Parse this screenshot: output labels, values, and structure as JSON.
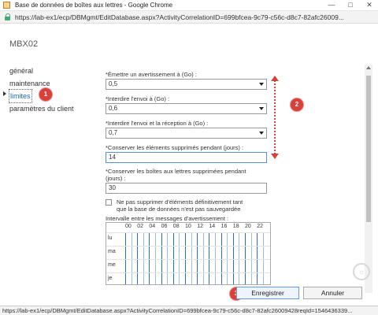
{
  "window": {
    "title": "Base de données de boîtes aux lettres - Google Chrome",
    "url": "https://lab-ex1/ecp/DBMgmt/EditDatabase.aspx?ActivityCorrelationID=699bfcea-9c79-c56c-d8c7-82afc26009...",
    "controls": [
      "—",
      "□",
      "✕"
    ]
  },
  "server_name": "MBX02",
  "nav": {
    "items": [
      {
        "label": "général"
      },
      {
        "label": "maintenance"
      },
      {
        "label": "limites"
      },
      {
        "label": "paramètres du client"
      }
    ]
  },
  "form": {
    "warn_label": "*Émettre un avertissement à (Go) :",
    "warn_value": "0,5",
    "prohibit_send_label": "*Interdire l'envoi à (Go) :",
    "prohibit_send_value": "0,6",
    "prohibit_send_receive_label": "*Interdire l'envoi et la réception à (Go) :",
    "prohibit_send_receive_value": "0,7",
    "keep_deleted_items_label": "*Conserver les éléments supprimés pendant (jours) :",
    "keep_deleted_items_value": "14",
    "keep_deleted_mailboxes_label_1": "*Conserver les boîtes aux lettres supprimées pendant",
    "keep_deleted_mailboxes_label_2": "(jours) :",
    "keep_deleted_mailboxes_value": "30",
    "checkbox_text_1": "Ne pas supprimer d'éléments définitivement tant",
    "checkbox_text_2": "que la base de données n'est pas sauvegardée",
    "checkbox_checked": false,
    "interval_label": "Intervalle entre les messages d'avertissement :"
  },
  "schedule": {
    "hours": [
      "00",
      "02",
      "04",
      "06",
      "08",
      "10",
      "12",
      "14",
      "16",
      "18",
      "20",
      "22"
    ],
    "days": [
      "lu",
      "ma",
      "me",
      "je"
    ]
  },
  "buttons": {
    "save": "Enregistrer",
    "cancel": "Annuler"
  },
  "badges": [
    "1",
    "2",
    "3"
  ],
  "status_bar": "https://lab-ex1/ecp/DBMgmt/EditDatabase.aspx?ActivityCorrelationID=699bfcea-9c79-c56c-d8c7-82afc26009428reqId=1546436339...",
  "colors": {
    "badge": "#d9403a",
    "link": "#1a6bb8",
    "grid_selected": "#2a6dd0"
  }
}
